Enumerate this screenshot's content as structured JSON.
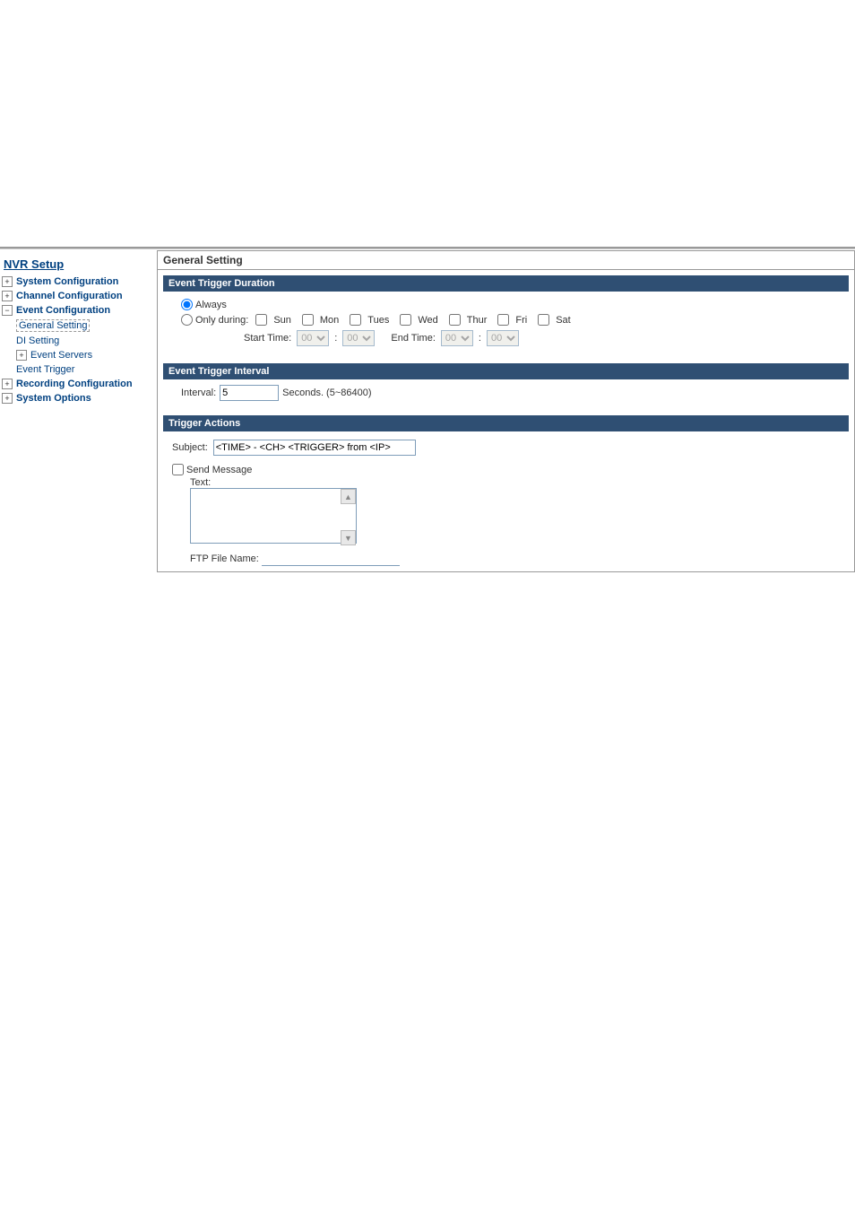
{
  "sidebar": {
    "title": "NVR Setup",
    "items": [
      {
        "expander": "+",
        "label": "System Configuration"
      },
      {
        "expander": "+",
        "label": "Channel Configuration"
      },
      {
        "expander": "−",
        "label": "Event Configuration"
      },
      {
        "expander": "+",
        "label": "Recording Configuration"
      },
      {
        "expander": "+",
        "label": "System Options"
      }
    ],
    "event_children": [
      {
        "label": "General Setting"
      },
      {
        "label": "DI Setting"
      },
      {
        "expander": "+",
        "label": "Event Servers"
      },
      {
        "label": "Event Trigger"
      }
    ]
  },
  "panel": {
    "title": "General Setting",
    "duration": {
      "header": "Event Trigger Duration",
      "always_label": "Always",
      "only_during_label": "Only during:",
      "days": [
        "Sun",
        "Mon",
        "Tues",
        "Wed",
        "Thur",
        "Fri",
        "Sat"
      ],
      "start_label": "Start Time:",
      "end_label": "End Time:",
      "time_hh": "00",
      "time_mm": "00",
      "colon": ":"
    },
    "interval": {
      "header": "Event Trigger Interval",
      "label": "Interval:",
      "value": "5",
      "unit": "Seconds. (5~86400)"
    },
    "actions": {
      "header": "Trigger Actions",
      "subject_label": "Subject:",
      "subject_value": "<TIME> - <CH> <TRIGGER> from <IP>",
      "send_message_label": "Send Message",
      "text_label": "Text:",
      "ftp_label": "FTP  File Name:"
    }
  }
}
